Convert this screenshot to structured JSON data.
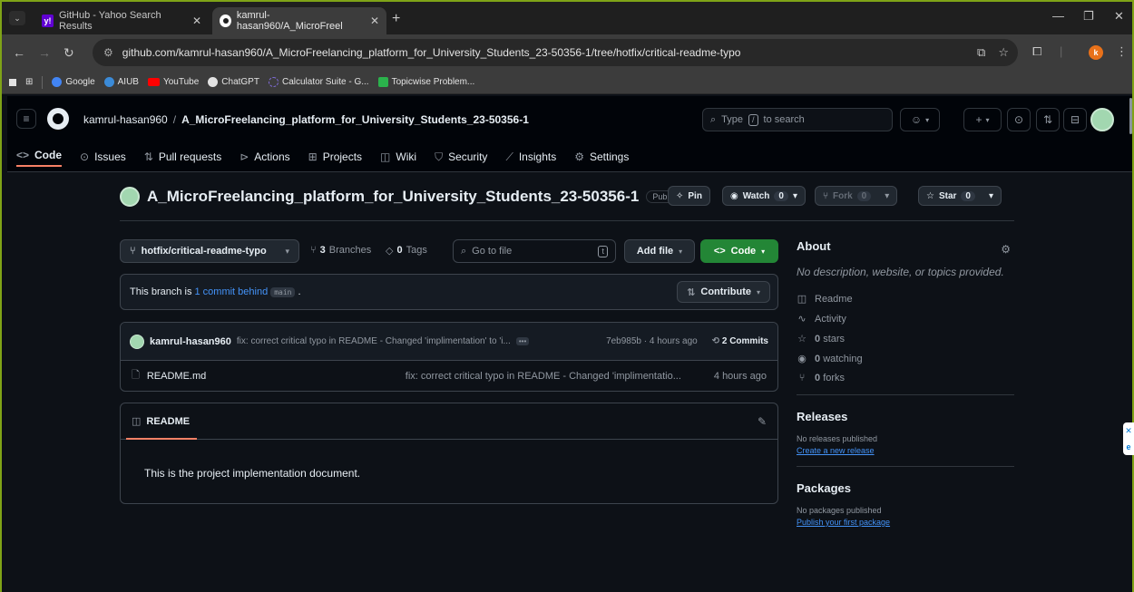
{
  "browser": {
    "tabs": [
      {
        "title": "GitHub - Yahoo Search Results",
        "active": false
      },
      {
        "title": "kamrul-hasan960/A_MicroFreel",
        "active": true
      }
    ],
    "url": "github.com/kamrul-hasan960/A_MicroFreelancing_platform_for_University_Students_23-50356-1/tree/hotfix/critical-readme-typo",
    "profile_initial": "k",
    "bookmarks": [
      {
        "label": "Google",
        "color": "#4285f4"
      },
      {
        "label": "AIUB",
        "color": "#3b8bd8"
      },
      {
        "label": "YouTube",
        "color": "#ff0000"
      },
      {
        "label": "ChatGPT",
        "color": "#ffffff"
      },
      {
        "label": "Calculator Suite - G...",
        "color": "#7f6bd6"
      },
      {
        "label": "Topicwise Problem...",
        "color": "#2bb24c"
      }
    ]
  },
  "header": {
    "owner": "kamrul-hasan960",
    "separator": "/",
    "repo": "A_MicroFreelancing_platform_for_University_Students_23-50356-1",
    "search_placeholder_pre": "Type",
    "search_key": "/",
    "search_placeholder_post": "to search"
  },
  "reponav": [
    {
      "label": "Code",
      "icon": "code-icon"
    },
    {
      "label": "Issues",
      "icon": "issue-icon"
    },
    {
      "label": "Pull requests",
      "icon": "pull-request-icon"
    },
    {
      "label": "Actions",
      "icon": "play-icon"
    },
    {
      "label": "Projects",
      "icon": "table-icon"
    },
    {
      "label": "Wiki",
      "icon": "book-icon"
    },
    {
      "label": "Security",
      "icon": "shield-icon"
    },
    {
      "label": "Insights",
      "icon": "graph-icon"
    },
    {
      "label": "Settings",
      "icon": "gear-icon"
    }
  ],
  "repo": {
    "name": "A_MicroFreelancing_platform_for_University_Students_23-50356-1",
    "visibility": "Public",
    "pin_label": "Pin",
    "watch_label": "Watch",
    "watch_count": "0",
    "fork_label": "Fork",
    "fork_count": "0",
    "star_label": "Star",
    "star_count": "0"
  },
  "toolbar": {
    "branch": "hotfix/critical-readme-typo",
    "branches_count": "3",
    "branches_label": "Branches",
    "tags_count": "0",
    "tags_label": "Tags",
    "goto_placeholder": "Go to file",
    "goto_key": "t",
    "add_file": "Add file",
    "code": "Code"
  },
  "branch_status": {
    "prefix": "This branch is",
    "link": "1 commit behind",
    "base": "main",
    "suffix": ".",
    "contribute": "Contribute"
  },
  "latest_commit": {
    "author": "kamrul-hasan960",
    "message": "fix: correct critical typo in README - Changed 'implimentation' to 'i...",
    "hash_time": "7eb985b · 4 hours ago",
    "commits_count": "2 Commits"
  },
  "files": [
    {
      "name": "README.md",
      "message": "fix: correct critical typo in README - Changed 'implimentatio...",
      "time": "4 hours ago"
    }
  ],
  "readme": {
    "tab": "README",
    "body": "This is the project implementation document."
  },
  "about": {
    "title": "About",
    "description": "No description, website, or topics provided.",
    "readme": "Readme",
    "activity": "Activity",
    "stars_count": "0",
    "stars_label": "stars",
    "watching_count": "0",
    "watching_label": "watching",
    "forks_count": "0",
    "forks_label": "forks"
  },
  "releases": {
    "title": "Releases",
    "empty": "No releases published",
    "link": "Create a new release"
  },
  "packages": {
    "title": "Packages",
    "empty": "No packages published",
    "link": "Publish your first package"
  }
}
